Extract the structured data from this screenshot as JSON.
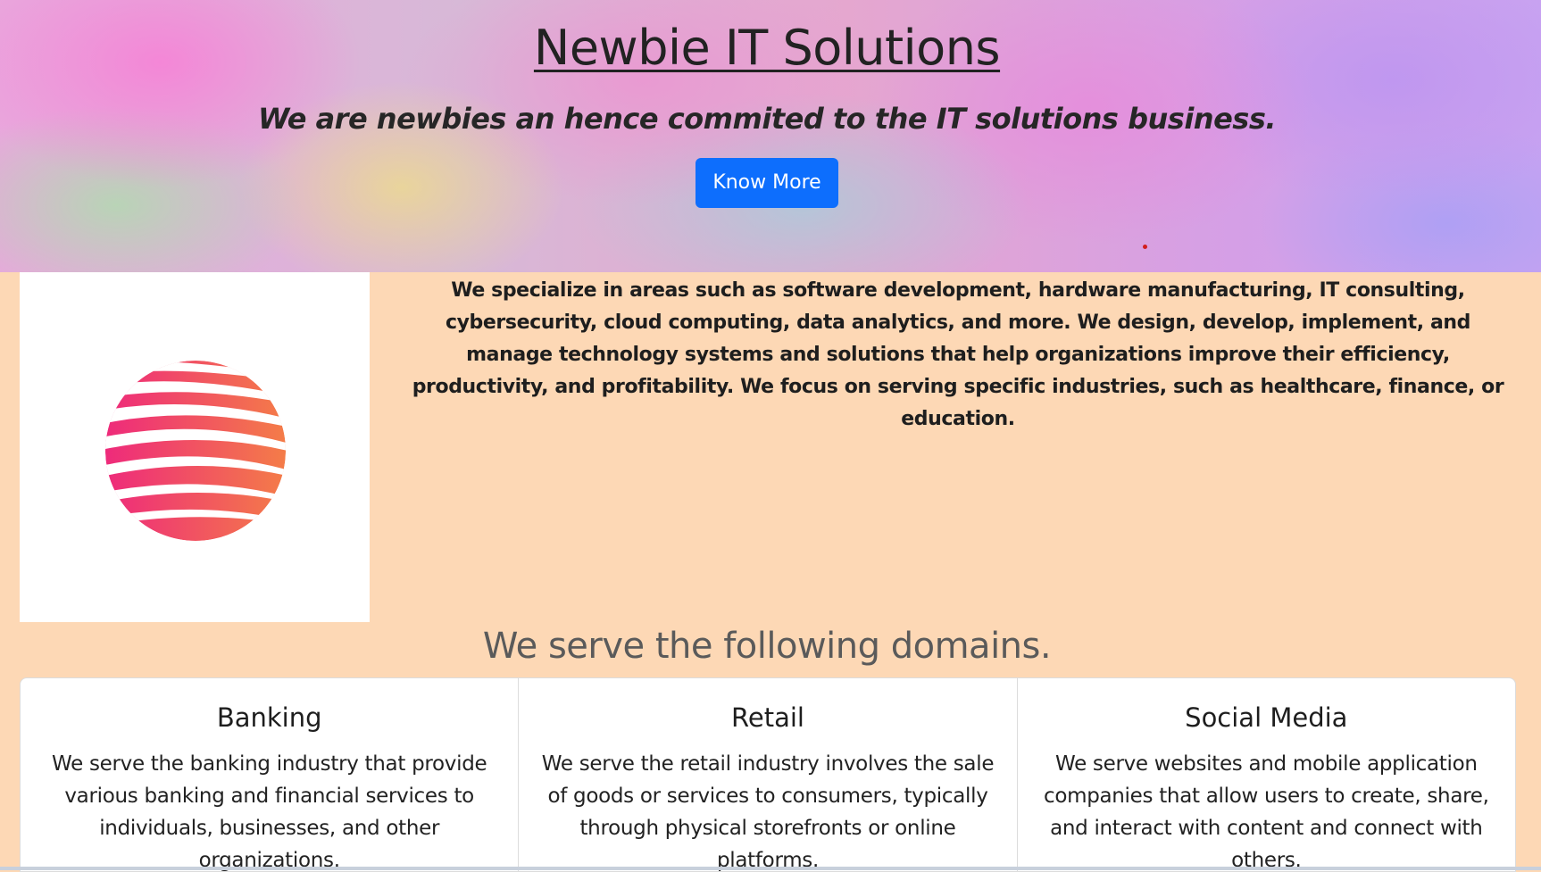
{
  "hero": {
    "title": "Newbie IT Solutions",
    "subtitle": "We are newbies an hence commited to the IT solutions business.",
    "button_label": "Know More"
  },
  "about": {
    "text": "We specialize in areas such as software development, hardware manufacturing, IT consulting, cybersecurity, cloud computing, data analytics, and more. We design, develop, implement, and manage technology systems and solutions that help organizations improve their efficiency, productivity, and profitability. We focus on serving specific industries, such as healthcare, finance, or education."
  },
  "domains": {
    "heading": "We serve the following domains.",
    "cards": [
      {
        "title": "Banking",
        "text": "We serve the banking industry that provide various banking and financial services to individuals, businesses, and other organizations."
      },
      {
        "title": "Retail",
        "text": "We serve the retail industry involves the sale of goods or services to consumers, typically through physical storefronts or online platforms."
      },
      {
        "title": "Social Media",
        "text": "We serve websites and mobile application companies that allow users to create, share, and interact with content and connect with others."
      }
    ]
  },
  "colors": {
    "page_background": "#fdd8b5",
    "button": "#0d6efd",
    "logo_gradient_start": "#ee2a7b",
    "logo_gradient_end": "#f47c48"
  }
}
